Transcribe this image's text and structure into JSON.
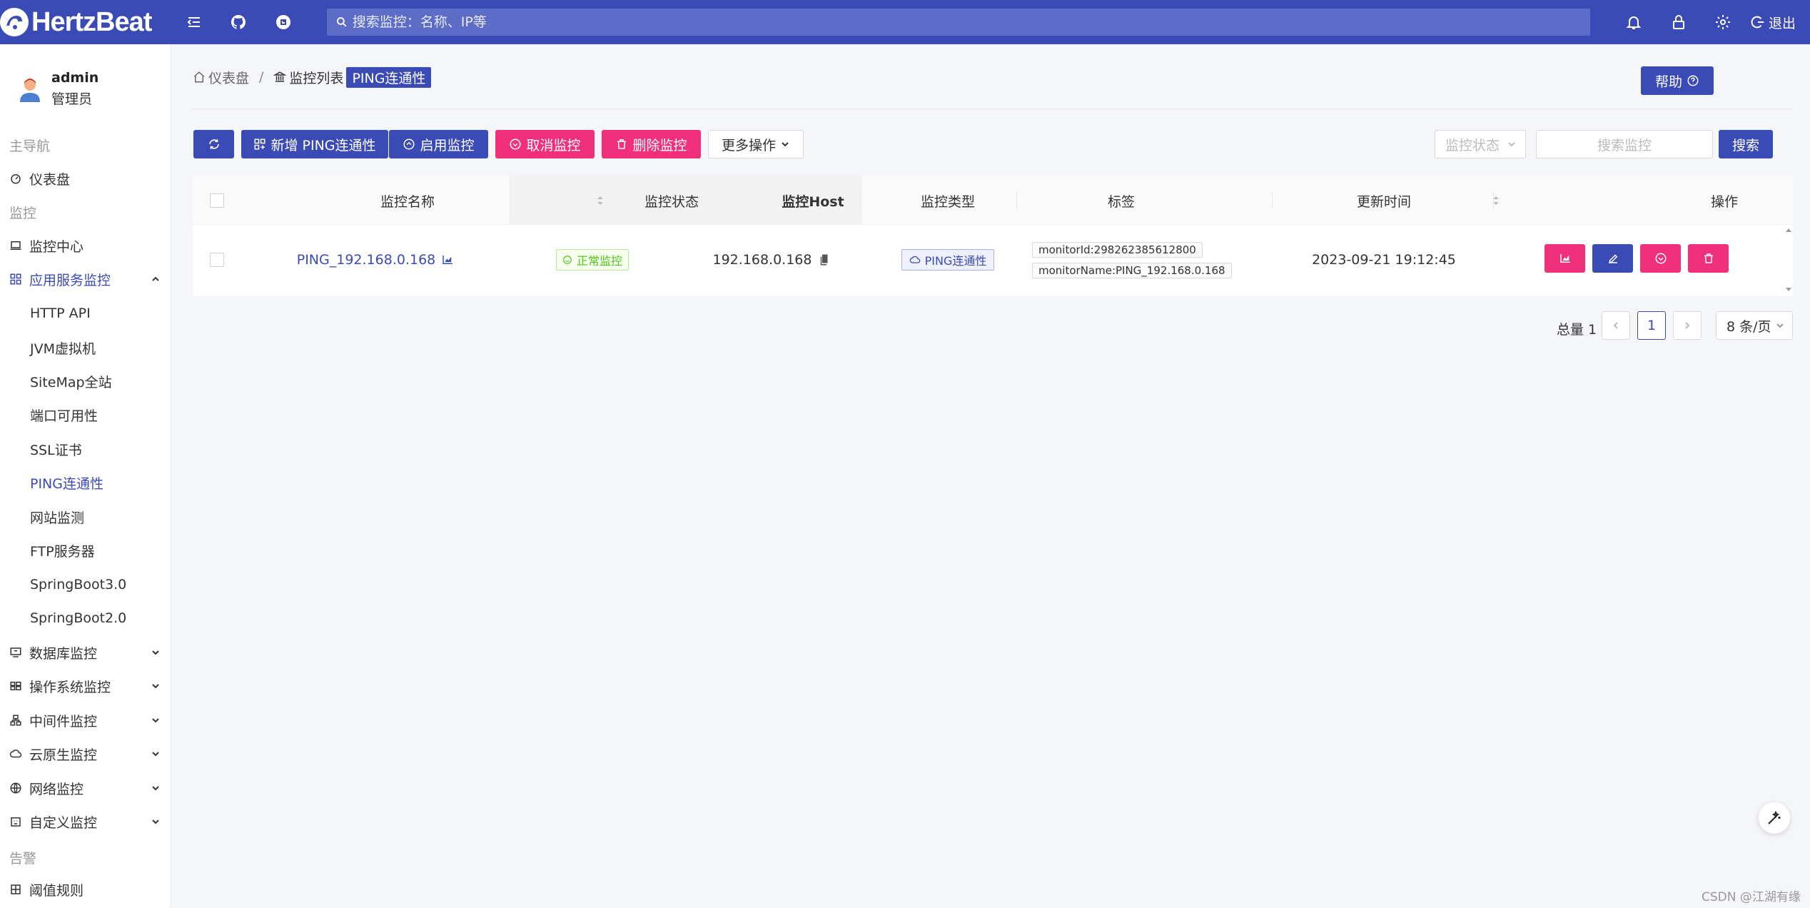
{
  "header": {
    "logo_text": "HertzBeat",
    "search_placeholder": "搜索监控：名称、IP等",
    "logout_label": "退出",
    "icons": [
      "menu-fold-icon",
      "github-icon",
      "gitee-icon",
      "bell-icon",
      "lock-icon",
      "gear-icon",
      "logout-icon"
    ]
  },
  "user": {
    "name": "admin",
    "role": "管理员"
  },
  "sidebar": {
    "group_main": "主导航",
    "dashboard": "仪表盘",
    "group_monitor": "监控",
    "monitor_center": "监控中心",
    "app_service": "应用服务监控",
    "sub_items": [
      "HTTP API",
      "JVM虚拟机",
      "SiteMap全站",
      "端口可用性",
      "SSL证书",
      "PING连通性",
      "网站监测",
      "FTP服务器",
      "SpringBoot3.0",
      "SpringBoot2.0"
    ],
    "active_sub": "PING连通性",
    "collapsed": [
      "数据库监控",
      "操作系统监控",
      "中间件监控",
      "云原生监控",
      "网络监控",
      "自定义监控"
    ],
    "group_alert": "告警",
    "threshold": "阈值规则"
  },
  "breadcrumb": {
    "home": "仪表盘",
    "list": "监控列表",
    "current": "PING连通性"
  },
  "help_label": "帮助",
  "toolbar": {
    "add_label": "新增 PING连通性",
    "enable_label": "启用监控",
    "cancel_label": "取消监控",
    "delete_label": "删除监控",
    "more_label": "更多操作",
    "status_placeholder": "监控状态",
    "search_placeholder": "搜索监控",
    "search_label": "搜索"
  },
  "table": {
    "columns": [
      "监控名称",
      "监控状态",
      "监控Host",
      "监控类型",
      "标签",
      "更新时间",
      "操作"
    ],
    "rows": [
      {
        "name": "PING_192.168.0.168",
        "status": "正常监控",
        "host": "192.168.0.168",
        "type": "PING连通性",
        "tags": [
          "monitorId:298262385612800",
          "monitorName:PING_192.168.0.168"
        ],
        "updated": "2023-09-21 19:12:45"
      }
    ]
  },
  "pagination": {
    "total_label": "总量 1",
    "current_page": "1",
    "page_size": "8 条/页"
  },
  "watermark": "CSDN @江湖有缘",
  "colors": {
    "primary": "#3b4bb5",
    "danger": "#f0307a",
    "success": "#52c41a"
  }
}
